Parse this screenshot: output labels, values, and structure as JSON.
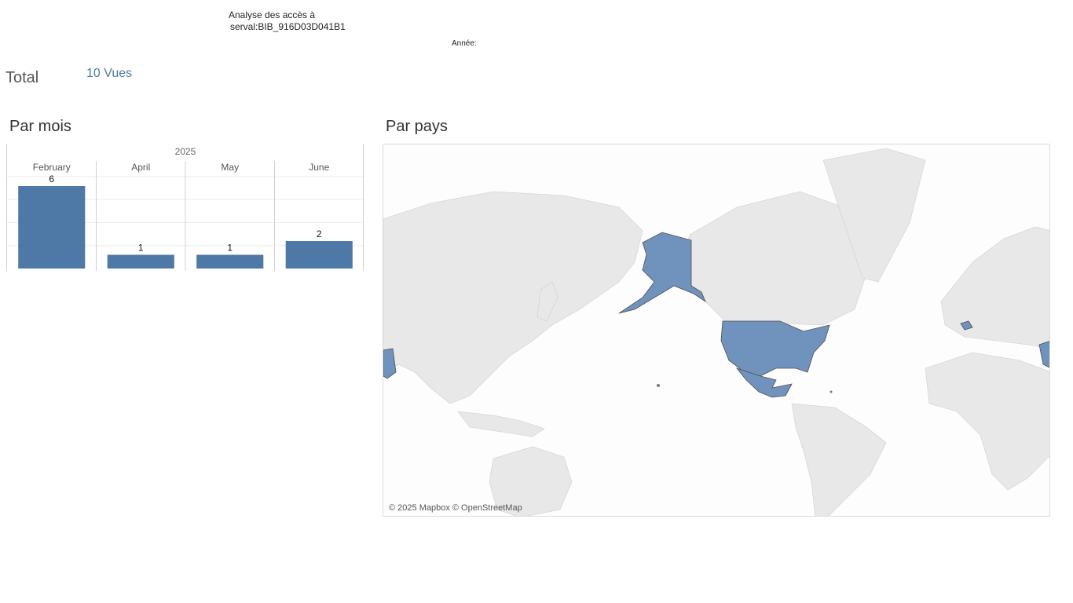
{
  "header": {
    "title_line1": "Analyse des accès à",
    "title_line2": "serval:BIB_916D03D041B1",
    "year_filter_label": "Année:"
  },
  "total": {
    "label": "Total",
    "value": "10 Vues"
  },
  "sections": {
    "by_month": "Par mois",
    "by_country": "Par pays"
  },
  "chart_data": {
    "type": "bar",
    "year_header": "2025",
    "categories": [
      "February",
      "April",
      "May",
      "June"
    ],
    "values": [
      6,
      1,
      1,
      2
    ],
    "ylim": [
      0,
      6
    ],
    "grid": true,
    "bar_color": "#4e79a7"
  },
  "map": {
    "attribution": "© 2025 Mapbox © OpenStreetMap",
    "land_color": "#e8e8e8",
    "highlight_color": "#6f93bd",
    "highlighted_regions": [
      "United States",
      "Mexico",
      "Switzerland",
      "Middle East"
    ]
  }
}
